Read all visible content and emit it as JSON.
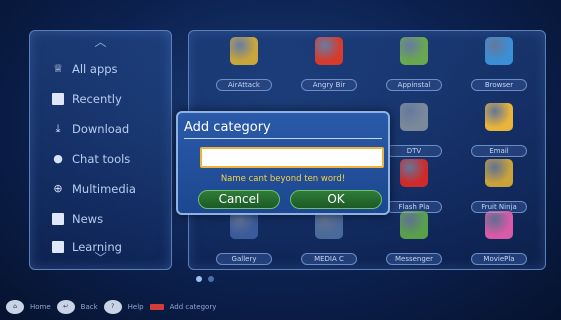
{
  "sidebar": {
    "items": [
      {
        "label": "All apps",
        "icon": "trophy-icon"
      },
      {
        "label": "Recently",
        "icon": "document-icon"
      },
      {
        "label": "Download",
        "icon": "download-icon"
      },
      {
        "label": "Chat tools",
        "icon": "chat-icon"
      },
      {
        "label": "Multimedia",
        "icon": "globe-icon"
      },
      {
        "label": "News",
        "icon": "news-icon"
      },
      {
        "label": "Learning",
        "icon": "book-icon"
      }
    ]
  },
  "apps": [
    {
      "label": "AirAttack",
      "color": "#c9a63a"
    },
    {
      "label": "Angry Bir",
      "color": "#d83a2c"
    },
    {
      "label": "Appinstal",
      "color": "#6aa84f"
    },
    {
      "label": "Browser",
      "color": "#3a8fd6"
    },
    {
      "label": "DTV",
      "color": "#7a8a9a"
    },
    {
      "label": "Email",
      "color": "#e8b43a"
    },
    {
      "label": "Flash Pla",
      "color": "#d02a2a"
    },
    {
      "label": "Fruit Ninja",
      "color": "#c9a23a"
    },
    {
      "label": "Gallery",
      "color": "#3a5a9a"
    },
    {
      "label": "MEDIA C",
      "color": "#4a6a9a"
    },
    {
      "label": "Messenger",
      "color": "#5aa04a"
    },
    {
      "label": "MoviePla",
      "color": "#d85aa8"
    }
  ],
  "hints": {
    "home": "Home",
    "back": "Back",
    "help": "Help",
    "add": "Add category"
  },
  "dialog": {
    "title": "Add category",
    "input_value": "",
    "message": "Name cant beyond ten word!",
    "cancel_label": "Cancel",
    "ok_label": "OK"
  }
}
